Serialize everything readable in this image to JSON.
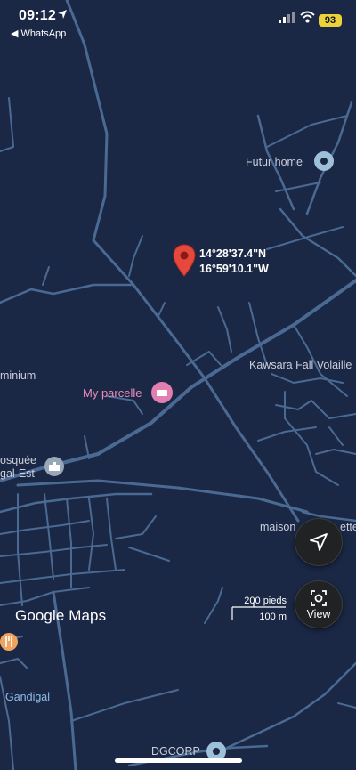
{
  "status_bar": {
    "time": "09:12",
    "back_app": "◀ WhatsApp",
    "battery": "93",
    "battery_color": "#e9d23a"
  },
  "map": {
    "background_color": "#1b2845",
    "road_color": "#4a6a93",
    "dropped_pin": {
      "latitude": "14°28'37.4\"N",
      "longitude": "16°59'10.1\"W",
      "icon": "red-map-pin-icon"
    },
    "places": {
      "futur_home": "Futur home",
      "kawsara": "Kawsara Fall Volaille",
      "my_parcelle": "My parcelle",
      "minium": "minium",
      "mosquee_line1": "osquée",
      "mosquee_line2": "gal-Est",
      "maison": "maison",
      "maison_end": "ette",
      "gandigal": "Gandigal",
      "dgcorp": "DGCORP"
    },
    "scale": {
      "imperial": "200 pieds",
      "metric": "100 m"
    },
    "logo": "Google Maps",
    "buttons": {
      "view_label": "View"
    }
  }
}
